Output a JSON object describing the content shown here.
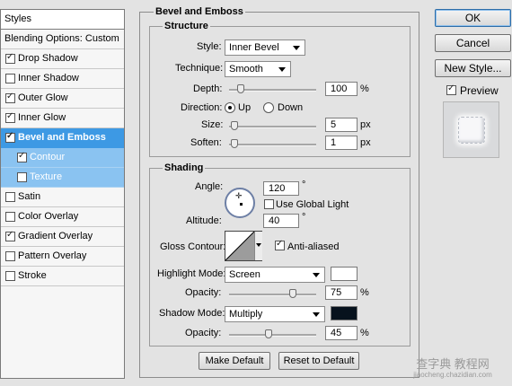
{
  "styles_panel": {
    "header": "Styles",
    "items": [
      {
        "label": "Blending Options: Custom",
        "checkbox": false,
        "checked": false,
        "state": "plain"
      },
      {
        "label": "Drop Shadow",
        "checkbox": true,
        "checked": true,
        "state": "normal"
      },
      {
        "label": "Inner Shadow",
        "checkbox": true,
        "checked": false,
        "state": "normal"
      },
      {
        "label": "Outer Glow",
        "checkbox": true,
        "checked": true,
        "state": "normal"
      },
      {
        "label": "Inner Glow",
        "checkbox": true,
        "checked": true,
        "state": "normal"
      },
      {
        "label": "Bevel and Emboss",
        "checkbox": true,
        "checked": true,
        "state": "selected"
      },
      {
        "label": "Contour",
        "checkbox": true,
        "checked": true,
        "state": "sub"
      },
      {
        "label": "Texture",
        "checkbox": true,
        "checked": false,
        "state": "sub"
      },
      {
        "label": "Satin",
        "checkbox": true,
        "checked": false,
        "state": "normal"
      },
      {
        "label": "Color Overlay",
        "checkbox": true,
        "checked": false,
        "state": "normal"
      },
      {
        "label": "Gradient Overlay",
        "checkbox": true,
        "checked": true,
        "state": "normal"
      },
      {
        "label": "Pattern Overlay",
        "checkbox": true,
        "checked": false,
        "state": "normal"
      },
      {
        "label": "Stroke",
        "checkbox": true,
        "checked": false,
        "state": "normal"
      }
    ]
  },
  "bevel": {
    "title": "Bevel and Emboss",
    "structure": {
      "title": "Structure",
      "style_label": "Style:",
      "style_value": "Inner Bevel",
      "technique_label": "Technique:",
      "technique_value": "Smooth",
      "depth_label": "Depth:",
      "depth_value": "100",
      "depth_unit": "%",
      "depth_level": 0.1,
      "direction_label": "Direction:",
      "direction_up": "Up",
      "direction_down": "Down",
      "direction_selected": "Up",
      "size_label": "Size:",
      "size_value": "5",
      "size_unit": "px",
      "size_level": 0.02,
      "soften_label": "Soften:",
      "soften_value": "1",
      "soften_unit": "px",
      "soften_level": 0.02
    },
    "shading": {
      "title": "Shading",
      "angle_label": "Angle:",
      "angle_value": "120",
      "angle_unit": "°",
      "global_light_label": "Use Global Light",
      "global_light_checked": false,
      "altitude_label": "Altitude:",
      "altitude_value": "40",
      "altitude_unit": "°",
      "gloss_label": "Gloss Contour:",
      "anti_aliased_label": "Anti-aliased",
      "anti_aliased_checked": true,
      "highlight_mode_label": "Highlight Mode:",
      "highlight_mode_value": "Screen",
      "highlight_color": "#ffffff",
      "highlight_opacity_label": "Opacity:",
      "highlight_opacity_value": "75",
      "highlight_opacity_unit": "%",
      "highlight_opacity_level": 0.75,
      "shadow_mode_label": "Shadow Mode:",
      "shadow_mode_value": "Multiply",
      "shadow_color": "#07121d",
      "shadow_opacity_label": "Opacity:",
      "shadow_opacity_value": "45",
      "shadow_opacity_unit": "%",
      "shadow_opacity_level": 0.45
    },
    "make_default": "Make Default",
    "reset_default": "Reset to Default"
  },
  "actions": {
    "ok": "OK",
    "cancel": "Cancel",
    "new_style": "New Style...",
    "preview_label": "Preview",
    "preview_checked": true
  },
  "watermark": {
    "line1": "查字典 教程网",
    "line2": "jiaocheng.chazidian.com"
  },
  "colors": {
    "selection": "#3d99e4",
    "sub_selection": "#8ac3f1"
  }
}
